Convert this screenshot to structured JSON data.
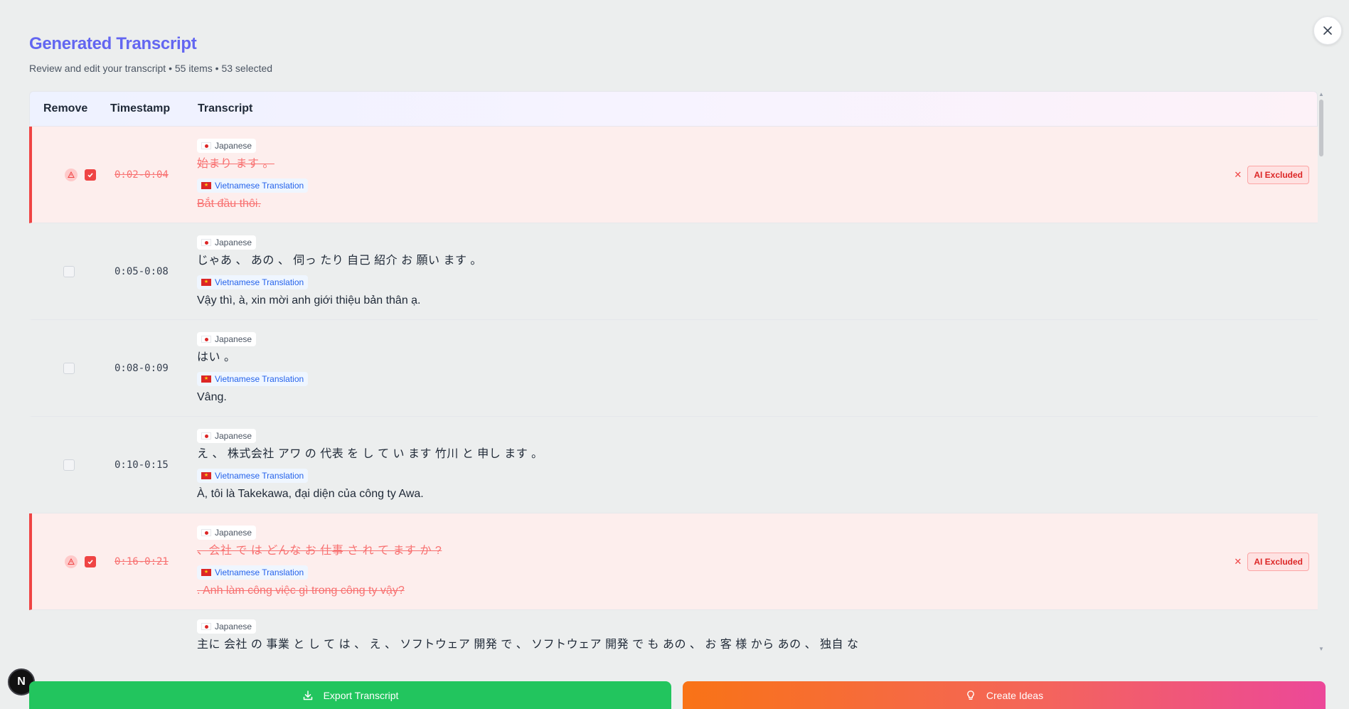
{
  "header": {
    "title": "Generated Transcript",
    "subtitle": "Review and edit your transcript • 55 items • 53 selected"
  },
  "table": {
    "columns": {
      "remove": "Remove",
      "timestamp": "Timestamp",
      "transcript": "Transcript"
    },
    "source_label": "Japanese",
    "translation_label": "Vietnamese Translation",
    "excluded_label": "AI Excluded",
    "rows": [
      {
        "timestamp": "0:02-0:04",
        "excluded": true,
        "checked": true,
        "japanese": "始まり ます 。",
        "vietnamese": "Bắt đầu thôi."
      },
      {
        "timestamp": "0:05-0:08",
        "excluded": false,
        "checked": false,
        "japanese": "じゃあ 、 あの 、 伺っ たり 自己 紹介 お 願い ます 。",
        "vietnamese": "Vậy thì, à, xin mời anh giới thiệu bản thân ạ."
      },
      {
        "timestamp": "0:08-0:09",
        "excluded": false,
        "checked": false,
        "japanese": "はい 。",
        "vietnamese": "Vâng."
      },
      {
        "timestamp": "0:10-0:15",
        "excluded": false,
        "checked": false,
        "japanese": "え 、 株式会社 アワ の 代表 を し て い ます 竹川 と 申し ます 。",
        "vietnamese": "À, tôi là Takekawa, đại diện của công ty Awa."
      },
      {
        "timestamp": "0:16-0:21",
        "excluded": true,
        "checked": true,
        "japanese": "、会社 で は どんな お 仕事 さ れ て ます か ?",
        "vietnamese": ". Anh làm công việc gì trong công ty vậy?"
      },
      {
        "japanese": "主に 会社 の 事業 と し て は 、 え 、 ソフトウェア 開発 で 、 ソフトウェア 開発 で も あの 、 お 客 様 から あの 、 独自 な"
      }
    ]
  },
  "actions": {
    "export_label": "Export Transcript",
    "ideas_label": "Create Ideas"
  },
  "badge": {
    "letter": "N"
  },
  "colors": {
    "title": "#6366f1",
    "excluded_accent": "#ef4444",
    "export": "#22c55e",
    "ideas_start": "#f97316",
    "ideas_end": "#ec4899"
  }
}
